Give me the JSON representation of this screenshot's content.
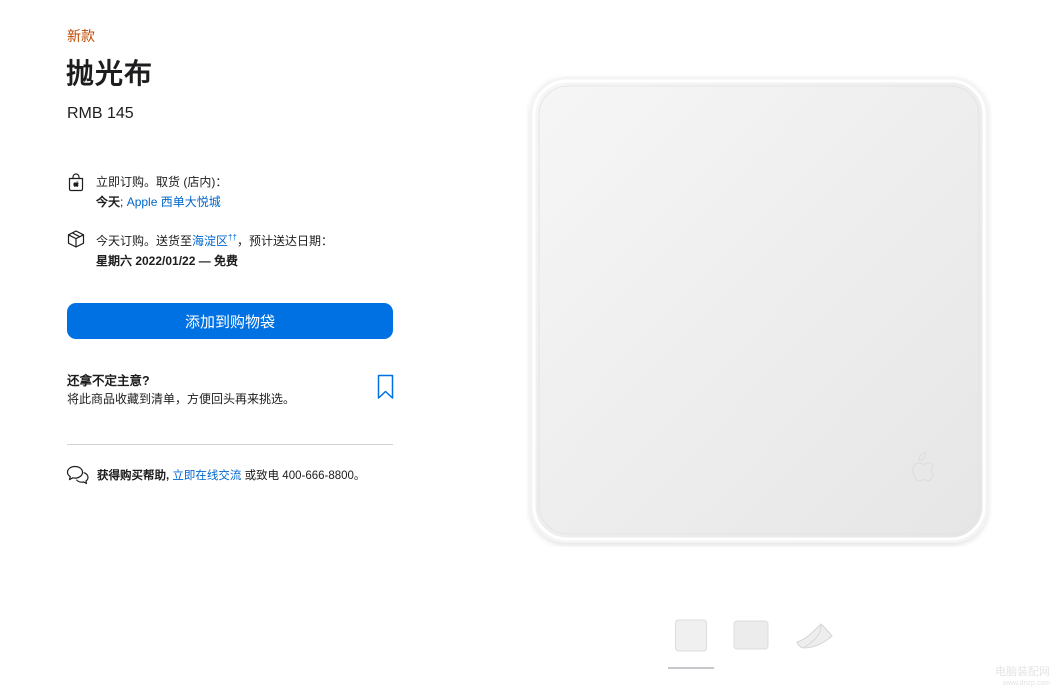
{
  "product": {
    "badge": "新款",
    "title": "抛光布",
    "price": "RMB 145"
  },
  "pickup": {
    "line1": "立即订购。取货 (店内)：",
    "day": "今天",
    "separator": ";",
    "store": "Apple 西单大悦城",
    "icon": "store-bag-icon"
  },
  "delivery": {
    "prefix": "今天订购。送货至",
    "area": "海淀区",
    "area_mark": "††",
    "suffix": "，预计送达日期：",
    "date_line": "星期六 2022/01/22 — 免费",
    "icon": "box-icon"
  },
  "cart_button": {
    "label": "添加到购物袋",
    "color": "#0071e3"
  },
  "undecided": {
    "title": "还拿不定主意?",
    "description": "将此商品收藏到清单，方便回头再来挑选。",
    "icon": "bookmark-icon"
  },
  "help": {
    "icon": "chat-bubbles-icon",
    "label": "获得购买帮助,",
    "chat_link": "立即在线交流",
    "phone_prefix": "或致电 400-666-8800。"
  },
  "gallery": {
    "thumbnails": [
      "cloth-front",
      "cloth-flat",
      "cloth-folded"
    ],
    "selected_index": 0
  },
  "watermark": {
    "line1": "电脑装配网",
    "line2": "www.dnzp.com"
  },
  "colors": {
    "accent": "#0071e3",
    "badge": "#bf4800",
    "link": "#0066cc"
  }
}
